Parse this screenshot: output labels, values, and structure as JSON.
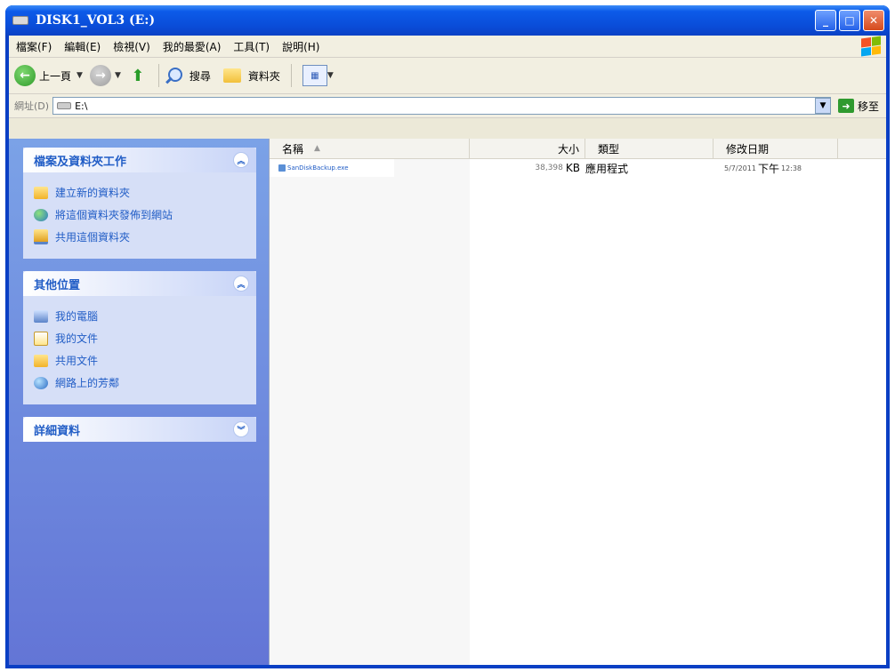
{
  "window": {
    "title": "DISK1_VOL3 (E:)",
    "controls": {
      "minimize": "_",
      "maximize": "□",
      "close": "✕"
    }
  },
  "menubar": {
    "items": [
      "檔案(F)",
      "編輯(E)",
      "檢視(V)",
      "我的最愛(A)",
      "工具(T)",
      "說明(H)"
    ]
  },
  "toolbar": {
    "back_label": "上一頁",
    "search_label": "搜尋",
    "folders_label": "資料夾"
  },
  "addressbar": {
    "label": "網址(D)",
    "value": "E:\\",
    "go_label": "移至"
  },
  "taskpane": {
    "file_tasks": {
      "title": "檔案及資料夾工作",
      "items": [
        "建立新的資料夾",
        "將這個資料夾發佈到網站",
        "共用這個資料夾"
      ]
    },
    "other_places": {
      "title": "其他位置",
      "items": [
        "我的電腦",
        "我的文件",
        "共用文件",
        "網路上的芳鄰"
      ]
    },
    "details": {
      "title": "詳細資料"
    }
  },
  "listview": {
    "columns": {
      "name": "名稱",
      "size": "大小",
      "type": "類型",
      "date": "修改日期"
    },
    "rows": [
      {
        "name": "SanDiskBackup.exe",
        "size_num": "38,398",
        "size_unit": "KB",
        "type": "應用程式",
        "date": "5/7/2011",
        "ampm": "下午",
        "time": "12:38"
      }
    ]
  },
  "colors": {
    "titlebar_blue": "#0a4cd8",
    "taskpane_blue": "#6375d6",
    "link_blue": "#215dc6"
  }
}
